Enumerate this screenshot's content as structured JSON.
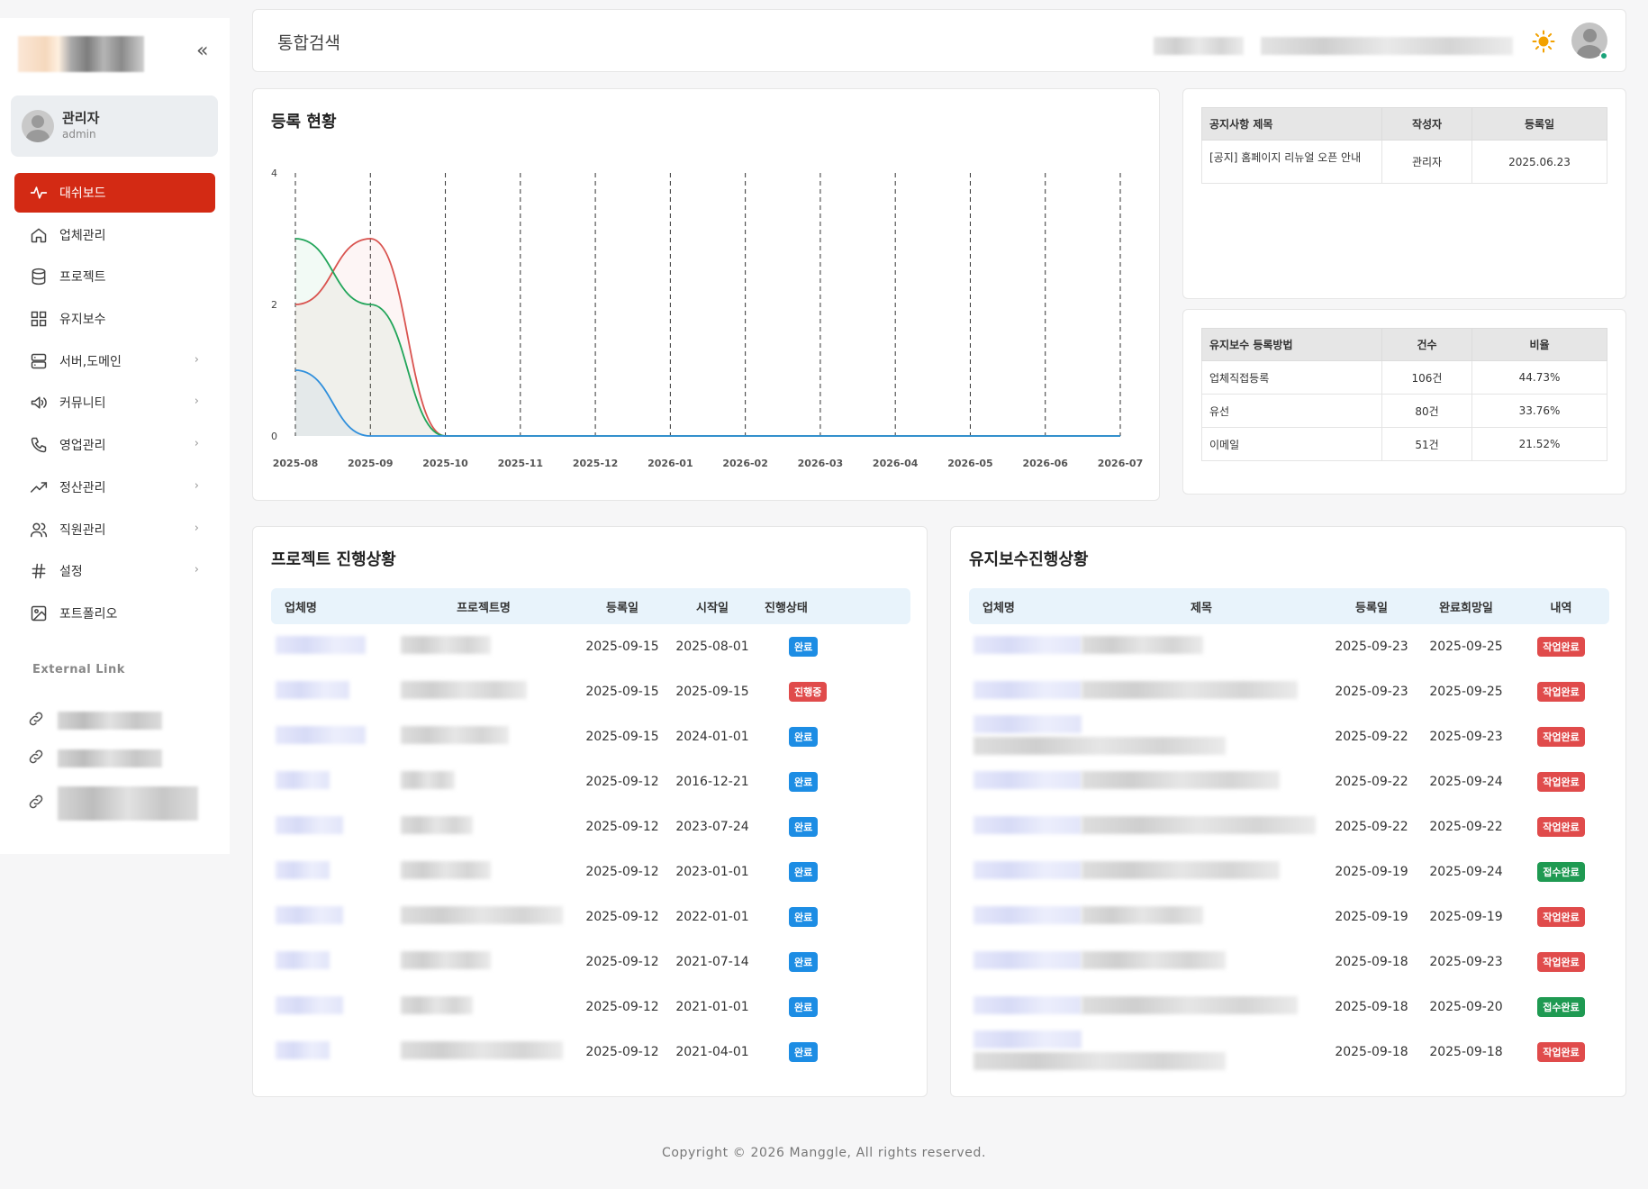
{
  "sidebar": {
    "user": {
      "name": "관리자",
      "id": "admin"
    },
    "menu": [
      {
        "label": "대쉬보드",
        "icon": "activity-icon",
        "active": true,
        "chevron": false
      },
      {
        "label": "업체관리",
        "icon": "home-icon",
        "chevron": false
      },
      {
        "label": "프로젝트",
        "icon": "database-icon",
        "chevron": false
      },
      {
        "label": "유지보수",
        "icon": "grid-icon",
        "chevron": false
      },
      {
        "label": "서버,도메인",
        "icon": "server-icon",
        "chevron": true
      },
      {
        "label": "커뮤니티",
        "icon": "megaphone-icon",
        "chevron": true
      },
      {
        "label": "영업관리",
        "icon": "phone-icon",
        "chevron": true
      },
      {
        "label": "정산관리",
        "icon": "trending-up-icon",
        "chevron": true
      },
      {
        "label": "직원관리",
        "icon": "users-icon",
        "chevron": true
      },
      {
        "label": "설정",
        "icon": "hash-icon",
        "chevron": true
      },
      {
        "label": "포트폴리오",
        "icon": "image-icon",
        "chevron": false
      }
    ],
    "external_title": "External Link",
    "chevron_glyph": "›",
    "collapse_glyph": "«"
  },
  "header": {
    "title": "통합검색"
  },
  "chart": {
    "title": "등록 현황",
    "chart_data": {
      "type": "line",
      "x": [
        "2025-08",
        "2025-09",
        "2025-10",
        "2025-11",
        "2025-12",
        "2026-01",
        "2026-02",
        "2026-03",
        "2026-04",
        "2026-05",
        "2026-06",
        "2026-07"
      ],
      "series": [
        {
          "values": [
            2,
            3,
            0,
            0,
            0,
            0,
            0,
            0,
            0,
            0,
            0,
            0
          ],
          "color": "#d9534f"
        },
        {
          "values": [
            3,
            2,
            0,
            0,
            0,
            0,
            0,
            0,
            0,
            0,
            0,
            0
          ],
          "color": "#22a55a"
        },
        {
          "values": [
            1,
            0,
            0,
            0,
            0,
            0,
            0,
            0,
            0,
            0,
            0,
            0
          ],
          "color": "#2f8fdc"
        }
      ],
      "yticks": [
        "0",
        "2",
        "4"
      ],
      "ylim": [
        0,
        4
      ],
      "grid": "vertical dashed"
    }
  },
  "notice": {
    "headers": [
      "공지사항 제목",
      "작성자",
      "등록일"
    ],
    "rows": [
      [
        "[공지] 홈페이지 리뉴얼 오픈 안내",
        "관리자",
        "2025.06.23"
      ]
    ]
  },
  "method": {
    "headers": [
      "유지보수 등록방법",
      "건수",
      "비율"
    ],
    "rows": [
      [
        "업체직접등록",
        "106건",
        "44.73%"
      ],
      [
        "유선",
        "80건",
        "33.76%"
      ],
      [
        "이메일",
        "51건",
        "21.52%"
      ]
    ]
  },
  "projects": {
    "title": "프로젝트 진행상황",
    "headers": [
      "업체명",
      "프로젝트명",
      "등록일",
      "시작일",
      "진행상태"
    ],
    "rows": [
      {
        "reg": "2025-09-15",
        "start": "2025-08-01",
        "status": "완료",
        "color": "blue"
      },
      {
        "reg": "2025-09-15",
        "start": "2025-09-15",
        "status": "진행중",
        "color": "red"
      },
      {
        "reg": "2025-09-15",
        "start": "2024-01-01",
        "status": "완료",
        "color": "blue"
      },
      {
        "reg": "2025-09-12",
        "start": "2016-12-21",
        "status": "완료",
        "color": "blue"
      },
      {
        "reg": "2025-09-12",
        "start": "2023-07-24",
        "status": "완료",
        "color": "blue"
      },
      {
        "reg": "2025-09-12",
        "start": "2023-01-01",
        "status": "완료",
        "color": "blue"
      },
      {
        "reg": "2025-09-12",
        "start": "2022-01-01",
        "status": "완료",
        "color": "blue"
      },
      {
        "reg": "2025-09-12",
        "start": "2021-07-14",
        "status": "완료",
        "color": "blue"
      },
      {
        "reg": "2025-09-12",
        "start": "2021-01-01",
        "status": "완료",
        "color": "blue"
      },
      {
        "reg": "2025-09-12",
        "start": "2021-04-01",
        "status": "완료",
        "color": "blue"
      }
    ]
  },
  "maintenance": {
    "title": "유지보수진행상황",
    "headers": [
      "업체명",
      "제목",
      "등록일",
      "완료희망일",
      "내역"
    ],
    "rows": [
      {
        "reg": "2025-09-23",
        "due": "2025-09-25",
        "status": "작업완료",
        "color": "red"
      },
      {
        "reg": "2025-09-23",
        "due": "2025-09-25",
        "status": "작업완료",
        "color": "red"
      },
      {
        "reg": "2025-09-22",
        "due": "2025-09-23",
        "status": "작업완료",
        "color": "red"
      },
      {
        "reg": "2025-09-22",
        "due": "2025-09-24",
        "status": "작업완료",
        "color": "red"
      },
      {
        "reg": "2025-09-22",
        "due": "2025-09-22",
        "status": "작업완료",
        "color": "red"
      },
      {
        "reg": "2025-09-19",
        "due": "2025-09-24",
        "status": "접수완료",
        "color": "green"
      },
      {
        "reg": "2025-09-19",
        "due": "2025-09-19",
        "status": "작업완료",
        "color": "red"
      },
      {
        "reg": "2025-09-18",
        "due": "2025-09-23",
        "status": "작업완료",
        "color": "red"
      },
      {
        "reg": "2025-09-18",
        "due": "2025-09-20",
        "status": "접수완료",
        "color": "green"
      },
      {
        "reg": "2025-09-18",
        "due": "2025-09-18",
        "status": "작업완료",
        "color": "red"
      }
    ]
  },
  "footer": {
    "text": "Copyright © 2026 Manggle, All rights reserved."
  }
}
